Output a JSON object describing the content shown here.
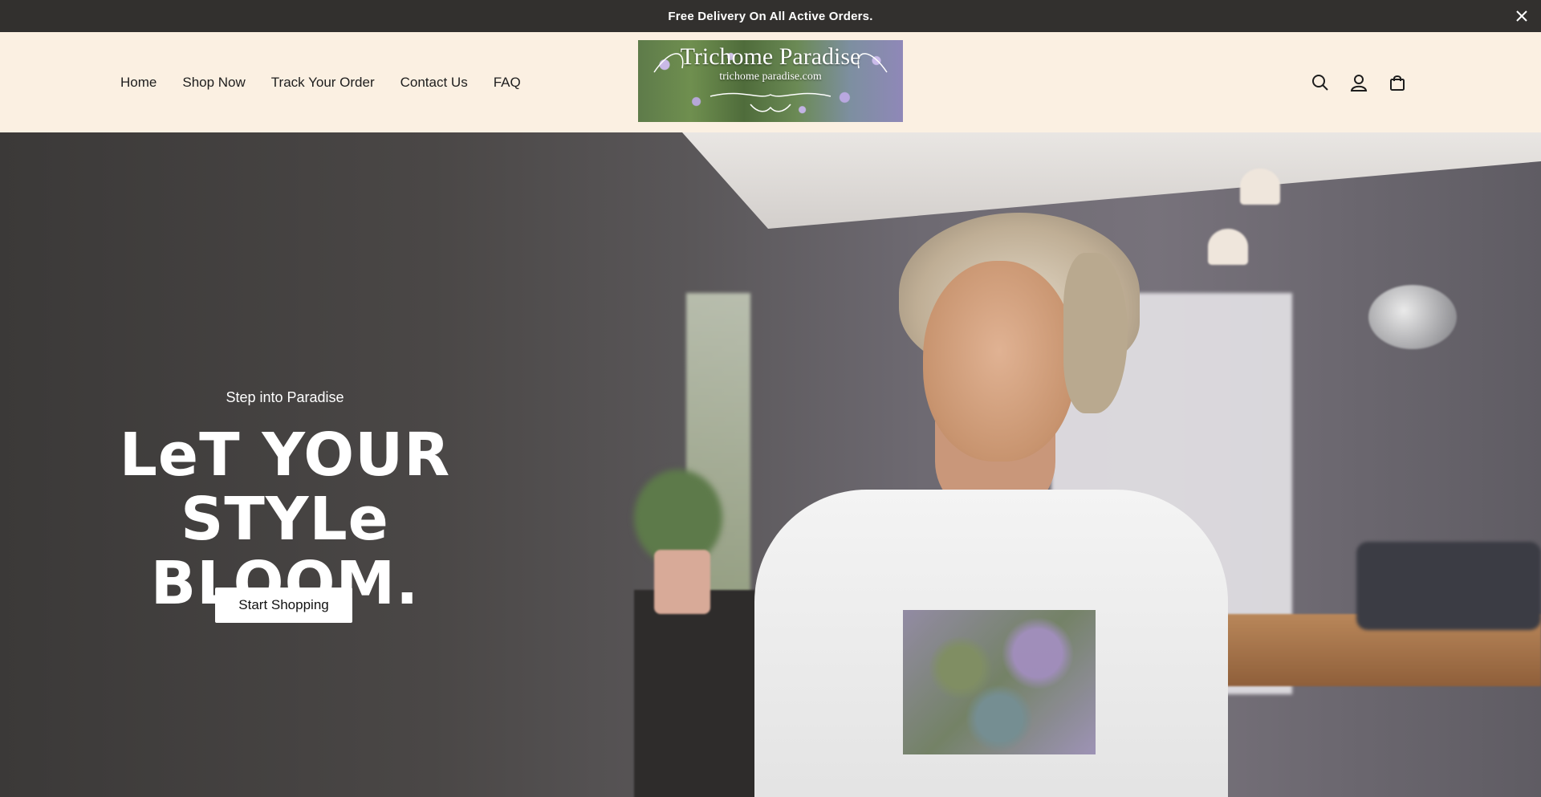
{
  "announcement": {
    "text": "Free Delivery On All Active Orders.",
    "close_icon": "close-icon"
  },
  "header": {
    "nav": [
      {
        "label": "Home"
      },
      {
        "label": "Shop Now"
      },
      {
        "label": "Track Your Order"
      },
      {
        "label": "Contact Us"
      },
      {
        "label": "FAQ"
      }
    ],
    "logo": {
      "title": "Trichome Paradise",
      "subtitle": "trichome paradise.com"
    },
    "icons": [
      "search-icon",
      "account-icon",
      "cart-icon"
    ]
  },
  "hero": {
    "eyebrow": "Step into Paradise",
    "headline_line1": "LeT YOUR",
    "headline_line2": "STYLe BLOOM.",
    "cta_label": "Start Shopping"
  },
  "colors": {
    "announcement_bg": "#32302e",
    "header_bg": "#fbf0e2",
    "cta_bg": "#ffffff",
    "text_dark": "#1d1d1d"
  }
}
